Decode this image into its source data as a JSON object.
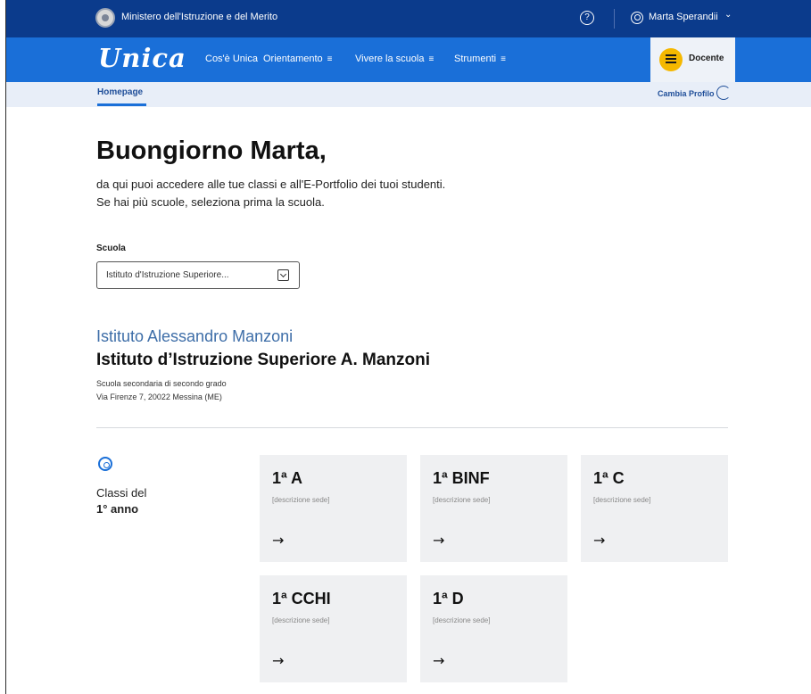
{
  "topbar": {
    "ministry": "Ministero dell'Istruzione e del Merito",
    "help_glyph": "?",
    "user_name": "Marta Sperandii",
    "chevron": "⌄"
  },
  "navbar": {
    "logo": "Unica",
    "items": [
      {
        "label": "Cos'è Unica",
        "menu": ""
      },
      {
        "label": "Orientamento",
        "menu": "≡"
      },
      {
        "label": "Vivere la scuola",
        "menu": "≡"
      },
      {
        "label": "Strumenti",
        "menu": "≡"
      }
    ],
    "role": "Docente"
  },
  "subbar": {
    "homepage": "Homepage",
    "switch_profile": "Cambia Profilo"
  },
  "main": {
    "greeting_prefix": "Buongiorno ",
    "greeting_name": "Marta,",
    "intro_line1": "da qui puoi accedere alle tue classi e all'E-Portfolio dei tuoi studenti.",
    "intro_line2": "Se hai più scuole, seleziona prima la scuola.",
    "school_label": "Scuola",
    "school_value": "Istituto d'Istruzione Superiore..."
  },
  "institute": {
    "name": "Istituto Alessandro Manzoni",
    "full_name": "Istituto d’Istruzione Superiore A. Manzoni",
    "type": "Scuola secondaria di secondo grado",
    "address": "Via Firenze 7, 20022 Messina (ME)"
  },
  "year_section": {
    "title_line1": "Classi del",
    "title_line2": "1° anno",
    "icon": "year-icon"
  },
  "classes": [
    {
      "name": "1ª A",
      "desc": "[descrizione sede]",
      "arrow": "→"
    },
    {
      "name": "1ª BINF",
      "desc": "[descrizione sede]",
      "arrow": "→"
    },
    {
      "name": "1ª C",
      "desc": "[descrizione sede]",
      "arrow": "→"
    },
    {
      "name": "1ª CCHI",
      "desc": "[descrizione sede]",
      "arrow": "→"
    },
    {
      "name": "1ª D",
      "desc": "[descrizione sede]",
      "arrow": "→"
    }
  ],
  "colors": {
    "topbar": "#0b3b8c",
    "navbar": "#1a6fd8",
    "subbar": "#e8eef8",
    "accent_yellow": "#f5b800",
    "institute_blue": "#3e6ea8",
    "card_bg": "#eff0f2"
  }
}
